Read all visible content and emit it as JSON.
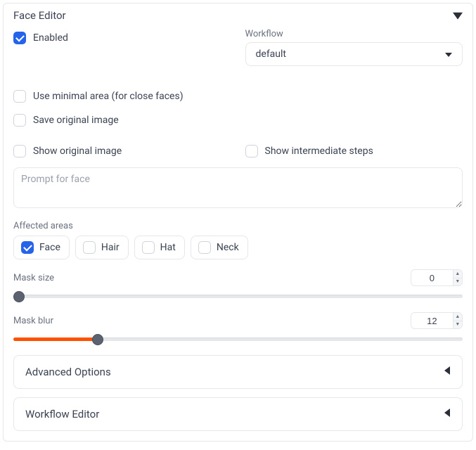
{
  "panel": {
    "title": "Face Editor"
  },
  "enabled": {
    "label": "Enabled",
    "checked": true
  },
  "workflow": {
    "label": "Workflow",
    "value": "default"
  },
  "opts": {
    "minimal_area": {
      "label": "Use minimal area (for close faces)",
      "checked": false
    },
    "save_original": {
      "label": "Save original image",
      "checked": false
    },
    "show_original": {
      "label": "Show original image",
      "checked": false
    },
    "show_intermediate": {
      "label": "Show intermediate steps",
      "checked": false
    }
  },
  "prompt": {
    "placeholder": "Prompt for face",
    "value": ""
  },
  "affected": {
    "label": "Affected areas",
    "items": [
      {
        "label": "Face",
        "checked": true
      },
      {
        "label": "Hair",
        "checked": false
      },
      {
        "label": "Hat",
        "checked": false
      },
      {
        "label": "Neck",
        "checked": false
      }
    ]
  },
  "mask_size": {
    "label": "Mask size",
    "value": 0,
    "min": 0,
    "max": 100
  },
  "mask_blur": {
    "label": "Mask blur",
    "value": 12,
    "min": 0,
    "max": 64
  },
  "sections": {
    "advanced": "Advanced Options",
    "workflow_editor": "Workflow Editor"
  }
}
